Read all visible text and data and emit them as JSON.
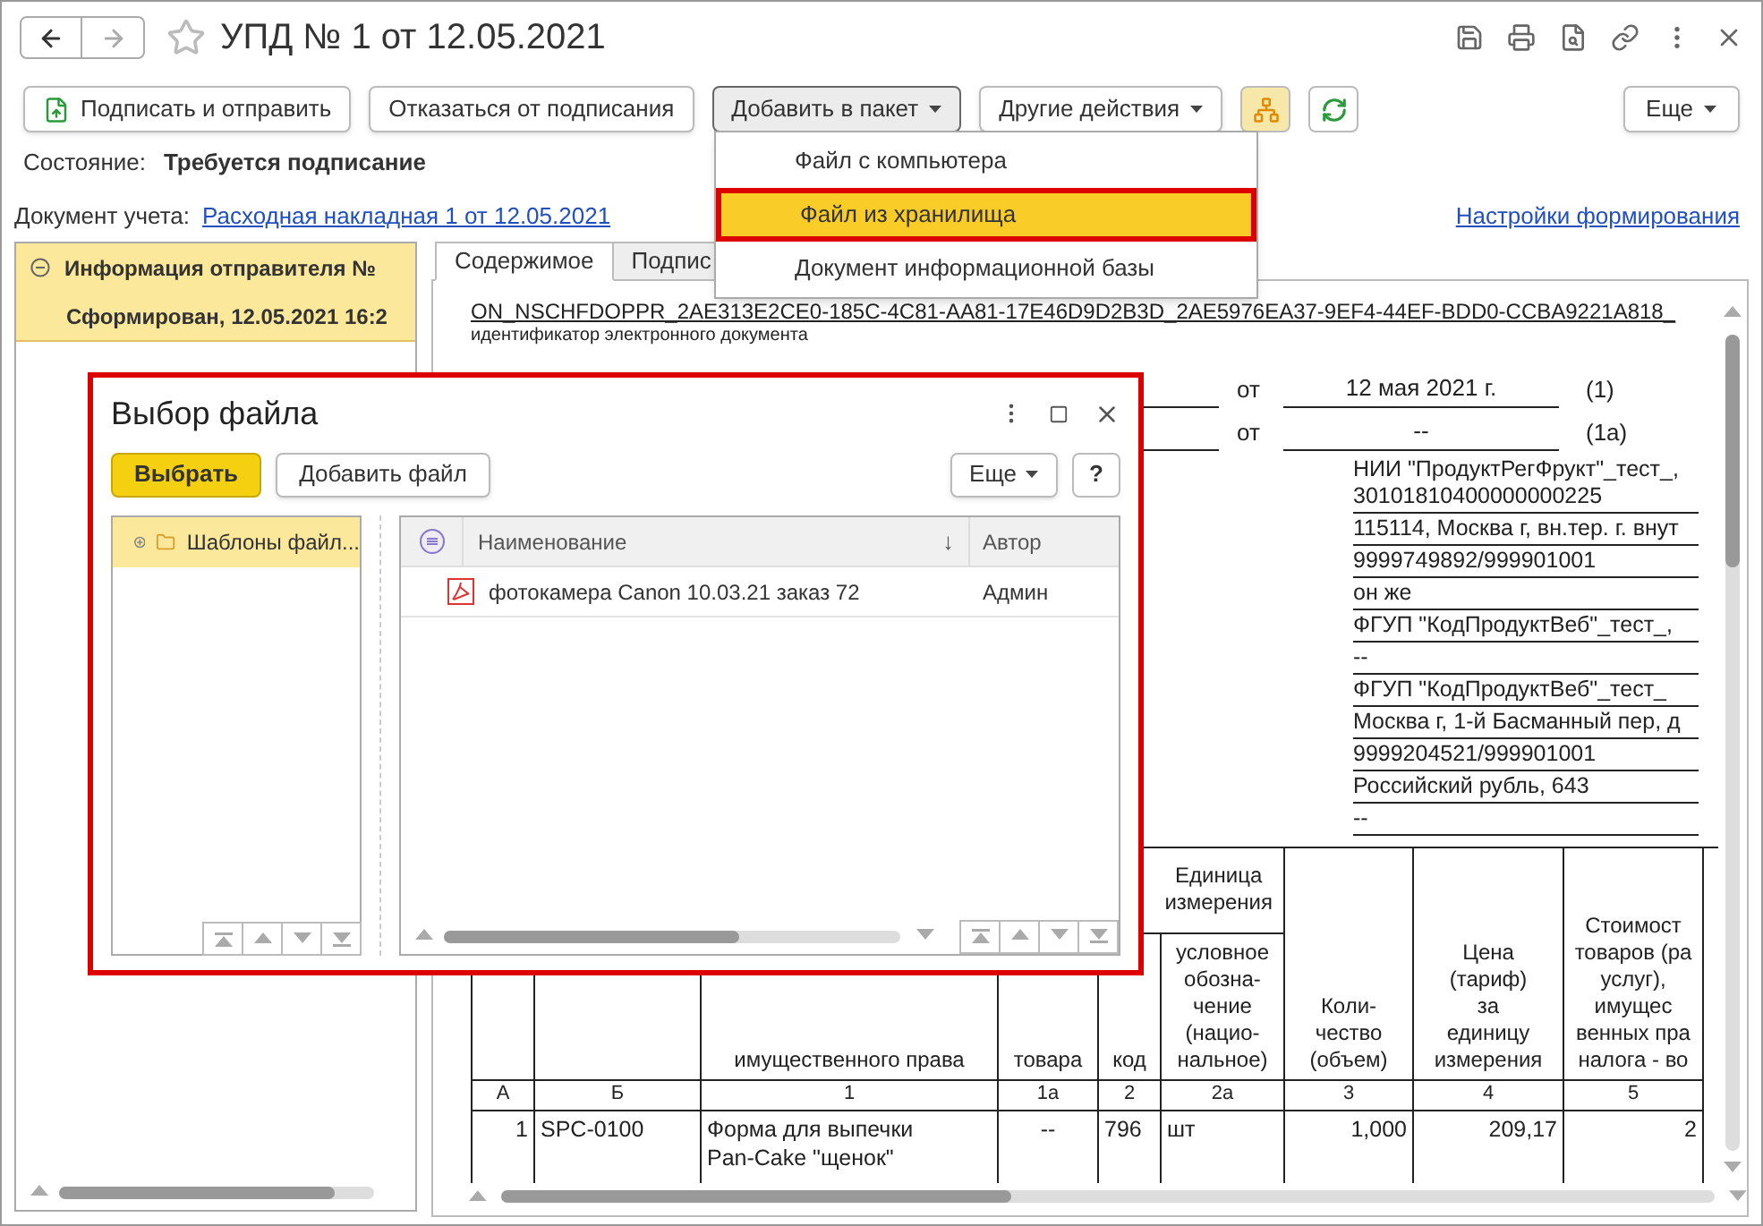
{
  "window": {
    "title": "УПД № 1 от 12.05.2021"
  },
  "toolbar": {
    "buttons": [
      {
        "label": "Подписать и отправить",
        "kind": "icon",
        "expanded": false
      },
      {
        "label": "Отказаться от подписания",
        "kind": "plain",
        "expanded": false
      },
      {
        "label": "Добавить в пакет",
        "kind": "dropdown",
        "expanded": true
      },
      {
        "label": "Другие действия",
        "kind": "dropdown",
        "expanded": false
      }
    ],
    "more": "Еще"
  },
  "state": {
    "label": "Состояние:",
    "value": "Требуется подписание"
  },
  "document": {
    "label": "Документ учета:",
    "link": "Расходная накладная 1 от 12.05.2021",
    "settings_link": "Настройки формирования"
  },
  "packet": {
    "title": "Информация отправителя №",
    "subtitle": "Сформирован, 12.05.2021 16:2",
    "selected": true
  },
  "tabs": [
    {
      "label": "Содержимое",
      "selected": true
    },
    {
      "label": "Подпис",
      "selected": false
    }
  ],
  "content": {
    "id": "ON_NSCHFDOPPR_2AE313E2CE0-185C-4C81-AA81-17E46D9D2B3D_2AE5976EA37-9EF4-44EF-BDD0-CCBA9221A818_",
    "id_caption": "идентификатор электронного документа",
    "dates": [
      {
        "label": "от",
        "value": "12 мая 2021 г.",
        "ref": "(1)"
      },
      {
        "label": "от",
        "value": "--",
        "ref": "(1а)"
      }
    ],
    "details": [
      "НИИ \"ПродуктРегФрукт\"_тест_,\n30101810400000000225",
      "115114, Москва г, вн.тер. г. внут",
      "9999749892/999901001",
      "он же",
      "ФГУП \"КодПродуктВеб\"_тест_,",
      "--",
      "ФГУП \"КодПродуктВеб\"_тест_",
      "Москва г, 1-й Басманный пер, д",
      "9999204521/999901001",
      "Российский рубль, 643",
      "--"
    ],
    "table": {
      "group_header": "Единица\nизмерения",
      "columns": [
        {
          "index": "А"
        },
        {
          "index": "Б"
        },
        {
          "header": "имущественного права",
          "index": "1"
        },
        {
          "header": "товара",
          "index": "1а"
        },
        {
          "header": "код",
          "index": "2"
        },
        {
          "header": "условное\nобозна-\nчение\n(нацио-\nнальное)",
          "index": "2а"
        },
        {
          "header": "Коли-\nчество\n(объем)",
          "index": "3"
        },
        {
          "header": "Цена\n(тариф)\nза\nединицу\nизмерения",
          "index": "4"
        },
        {
          "header": "Стоимост\nтоваров (ра\nуслуг),\nимущес\nвенных пра\nналога - во",
          "index": "5"
        }
      ],
      "rows": [
        [
          "1",
          "SPC-0100",
          "Форма для выпечки\nPan-Cake \"щенок\"",
          "--",
          "796",
          "шт",
          "1,000",
          "209,17",
          "2"
        ]
      ]
    }
  },
  "menu": {
    "items": [
      {
        "label": "Файл с компьютера",
        "selected": false
      },
      {
        "label": "Файл из хранилища",
        "selected": true
      },
      {
        "label": "Документ информационной базы",
        "selected": false
      }
    ]
  },
  "dialog": {
    "title": "Выбор файла",
    "buttons": {
      "primary": "Выбрать",
      "add": "Добавить файл",
      "more": "Еще",
      "help": "?"
    },
    "tree": [
      {
        "label": "Шаблоны файл...",
        "selected": true,
        "expanded": false
      }
    ],
    "columns": {
      "name": "Наименование",
      "sort": "↓",
      "author": "Автор"
    },
    "files": [
      {
        "name": "фотокамера Canon 10.03.21 заказ 72",
        "author": "Админ",
        "selected": false
      }
    ]
  }
}
